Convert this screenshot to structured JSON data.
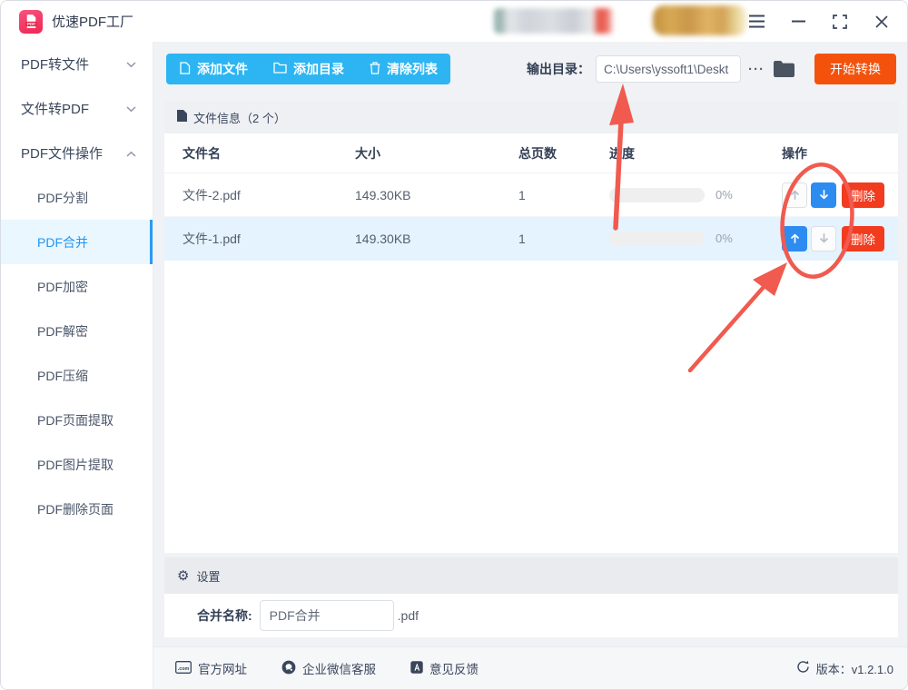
{
  "app": {
    "title": "优速PDF工厂"
  },
  "sidebar": {
    "items": [
      {
        "label": "PDF转文件",
        "type": "group",
        "chevron": "down"
      },
      {
        "label": "文件转PDF",
        "type": "group",
        "chevron": "down"
      },
      {
        "label": "PDF文件操作",
        "type": "group",
        "chevron": "up"
      },
      {
        "label": "PDF分割",
        "type": "sub",
        "active": false
      },
      {
        "label": "PDF合并",
        "type": "sub",
        "active": true
      },
      {
        "label": "PDF加密",
        "type": "sub",
        "active": false
      },
      {
        "label": "PDF解密",
        "type": "sub",
        "active": false
      },
      {
        "label": "PDF压缩",
        "type": "sub",
        "active": false
      },
      {
        "label": "PDF页面提取",
        "type": "sub",
        "active": false
      },
      {
        "label": "PDF图片提取",
        "type": "sub",
        "active": false
      },
      {
        "label": "PDF删除页面",
        "type": "sub",
        "active": false
      }
    ]
  },
  "toolbar": {
    "buttons": [
      {
        "label": "添加文件",
        "icon": "add-file-icon"
      },
      {
        "label": "添加目录",
        "icon": "add-folder-icon"
      },
      {
        "label": "清除列表",
        "icon": "clear-list-icon"
      }
    ],
    "output_label": "输出目录：",
    "output_path": "C:\\Users\\yssoft1\\Deskt",
    "more": "···",
    "start": "开始转换"
  },
  "table": {
    "info_header": "文件信息（2 个）",
    "columns": [
      "文件名",
      "大小",
      "总页数",
      "进度",
      "操作"
    ],
    "rows": [
      {
        "name": "文件-2.pdf",
        "size": "149.30KB",
        "pages": "1",
        "progress": "0%",
        "delete": "删除",
        "up_enabled": false,
        "down_enabled": true,
        "selected": false
      },
      {
        "name": "文件-1.pdf",
        "size": "149.30KB",
        "pages": "1",
        "progress": "0%",
        "delete": "删除",
        "up_enabled": true,
        "down_enabled": false,
        "selected": true
      }
    ]
  },
  "settings": {
    "header": "设置",
    "name_label": "合并名称:",
    "name_value": "PDF合并",
    "suffix": ".pdf"
  },
  "footer": {
    "links": [
      {
        "label": "官方网址",
        "icon": "website-icon"
      },
      {
        "label": "企业微信客服",
        "icon": "wechat-service-icon"
      },
      {
        "label": "意见反馈",
        "icon": "feedback-icon"
      }
    ],
    "version": "版本：v1.2.1.0"
  },
  "annotations": {
    "color": "#f15a4f",
    "shapes": [
      "red-ellipse-around-reorder-buttons",
      "red-arrow-to-output-directory-field",
      "red-arrow-to-reorder-buttons"
    ]
  }
}
